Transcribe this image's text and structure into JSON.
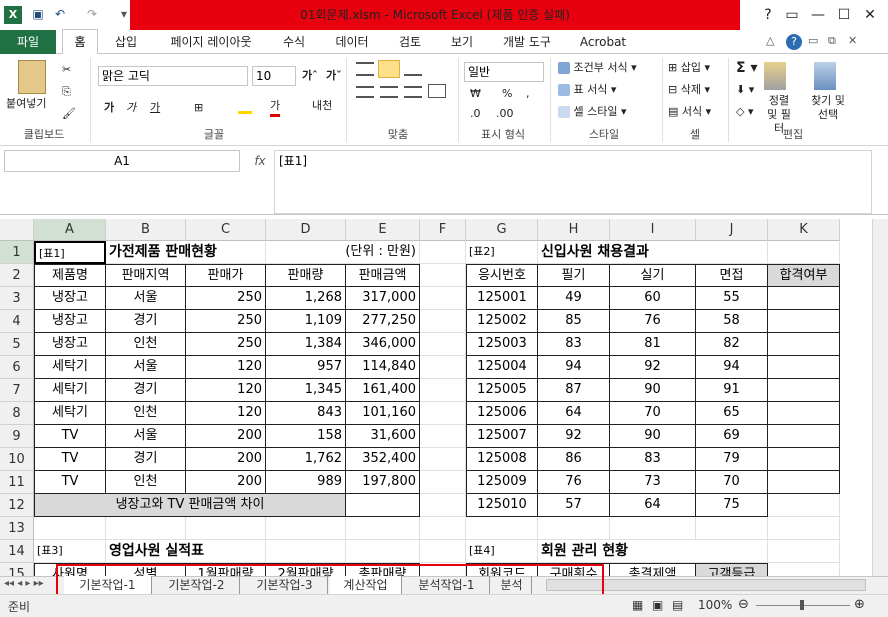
{
  "window": {
    "title": "01회문제.xlsm - Microsoft Excel (제품 인증 실패)"
  },
  "qat": {
    "undo": "↶",
    "redo": "↷"
  },
  "ribbon_tabs": [
    "파일",
    "홈",
    "삽입",
    "페이지 레이아웃",
    "수식",
    "데이터",
    "검토",
    "보기",
    "개발 도구",
    "Acrobat"
  ],
  "ribbon": {
    "paste": "붙여넣기",
    "font_name": "맑은 고딕",
    "font_size": "10",
    "number_format": "일반",
    "cond_format": "조건부 서식",
    "table_format": "표 서식",
    "cell_style": "셀 스타일",
    "insert": "삽입",
    "delete": "삭제",
    "format": "서식",
    "sort_filter": "정렬 및 필터",
    "find_select": "찾기 및 선택",
    "groups": {
      "clipboard": "클립보드",
      "font": "글꼴",
      "align": "맞춤",
      "number": "표시 형식",
      "style": "스타일",
      "cells": "셀",
      "edit": "편집"
    }
  },
  "formula_bar": {
    "name_box": "A1",
    "fx": "fx",
    "content": "[표1]"
  },
  "columns": [
    "A",
    "B",
    "C",
    "D",
    "E",
    "F",
    "G",
    "H",
    "I",
    "J",
    "K"
  ],
  "rows": [
    "1",
    "2",
    "3",
    "4",
    "5",
    "6",
    "7",
    "8",
    "9",
    "10",
    "11",
    "12",
    "13",
    "14",
    "15"
  ],
  "table1": {
    "tag": "[표1]",
    "title": "가전제품 판매현황",
    "unit": "(단위 : 만원)",
    "headers": [
      "제품명",
      "판매지역",
      "판매가",
      "판매량",
      "판매금액"
    ],
    "rows": [
      [
        "냉장고",
        "서울",
        "250",
        "1,268",
        "317,000"
      ],
      [
        "냉장고",
        "경기",
        "250",
        "1,109",
        "277,250"
      ],
      [
        "냉장고",
        "인천",
        "250",
        "1,384",
        "346,000"
      ],
      [
        "세탁기",
        "서울",
        "120",
        "957",
        "114,840"
      ],
      [
        "세탁기",
        "경기",
        "120",
        "1,345",
        "161,400"
      ],
      [
        "세탁기",
        "인천",
        "120",
        "843",
        "101,160"
      ],
      [
        "TV",
        "서울",
        "200",
        "158",
        "31,600"
      ],
      [
        "TV",
        "경기",
        "200",
        "1,762",
        "352,400"
      ],
      [
        "TV",
        "인천",
        "200",
        "989",
        "197,800"
      ]
    ],
    "footer": "냉장고와 TV 판매금액 차이"
  },
  "table2": {
    "tag": "[표2]",
    "title": "신입사원 채용결과",
    "headers": [
      "응시번호",
      "필기",
      "실기",
      "면접",
      "합격여부"
    ],
    "rows": [
      [
        "125001",
        "49",
        "60",
        "55"
      ],
      [
        "125002",
        "85",
        "76",
        "58"
      ],
      [
        "125003",
        "83",
        "81",
        "82"
      ],
      [
        "125004",
        "94",
        "92",
        "94"
      ],
      [
        "125005",
        "87",
        "90",
        "91"
      ],
      [
        "125006",
        "64",
        "70",
        "65"
      ],
      [
        "125007",
        "92",
        "90",
        "69"
      ],
      [
        "125008",
        "86",
        "83",
        "79"
      ],
      [
        "125009",
        "76",
        "73",
        "70"
      ],
      [
        "125010",
        "57",
        "64",
        "75"
      ]
    ]
  },
  "table3": {
    "tag": "[표3]",
    "title": "영업사원 실적표",
    "headers": [
      "사원명",
      "성별",
      "1월판매량",
      "2월판매량",
      "총판매량"
    ]
  },
  "table4": {
    "tag": "[표4]",
    "title": "회원 관리 현황",
    "headers": [
      "회원코드",
      "구매횟수",
      "총결제액",
      "고객등급"
    ]
  },
  "sheets": [
    "기본작업-1",
    "기본작업-2",
    "기본작업-3",
    "계산작업",
    "분석작업-1",
    "분석"
  ],
  "status": {
    "ready": "준비",
    "zoom": "100%"
  }
}
